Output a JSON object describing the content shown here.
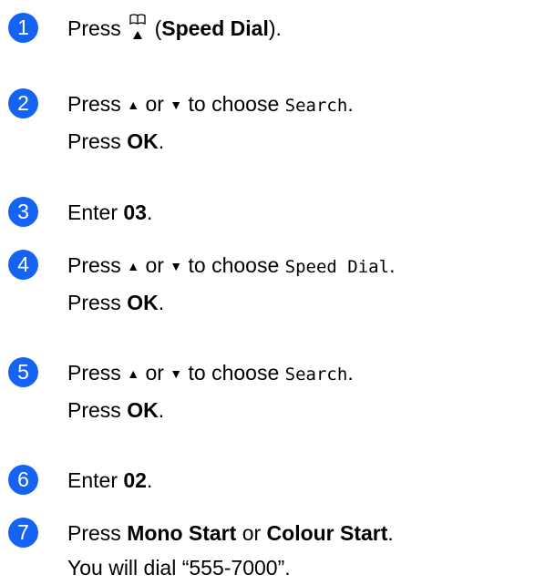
{
  "steps": [
    {
      "number": "1",
      "press": "Press",
      "open_paren": "(",
      "key": "Speed Dial",
      "close": ")."
    },
    {
      "number": "2",
      "press_up_down": "Press",
      "up": "▲",
      "or": "or",
      "down": "▼",
      "to_choose": "to choose",
      "option": "Search",
      "period": ".",
      "press": "Press",
      "key": "OK",
      "key_period": "."
    },
    {
      "number": "3",
      "enter": "Enter",
      "value": "03",
      "period": "."
    },
    {
      "number": "4",
      "press_up_down": "Press",
      "up": "▲",
      "or": "or",
      "down": "▼",
      "to_choose": "to choose",
      "option": "Speed Dial",
      "period": ".",
      "press": "Press",
      "key": "OK",
      "key_period": "."
    },
    {
      "number": "5",
      "press_up_down": "Press",
      "up": "▲",
      "or": "or",
      "down": "▼",
      "to_choose": "to choose",
      "option": "Search",
      "period": ".",
      "press": "Press",
      "key": "OK",
      "key_period": "."
    },
    {
      "number": "6",
      "enter": "Enter",
      "value": "02",
      "period": "."
    },
    {
      "number": "7",
      "press": "Press",
      "key1": "Mono Start",
      "or": "or",
      "key2": "Colour Start",
      "period": ".",
      "dial_text": "You will dial “555-7000”."
    }
  ],
  "colors": {
    "step_badge": "#1463f3",
    "text": "#000000"
  },
  "icons": {
    "speed_dial": "speed-dial-book-icon"
  }
}
